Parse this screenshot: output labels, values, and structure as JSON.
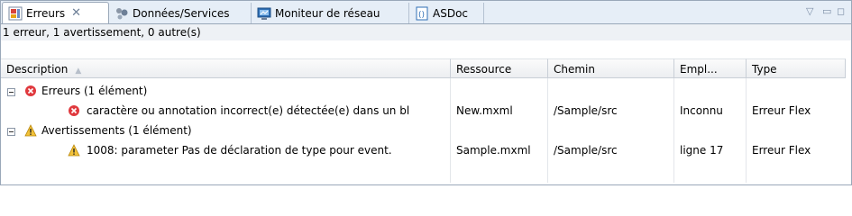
{
  "tabs": [
    {
      "label": "Erreurs",
      "icon": "problems-icon",
      "active": true,
      "closable": true
    },
    {
      "label": "Données/Services",
      "icon": "data-services-icon"
    },
    {
      "label": "Moniteur de réseau",
      "icon": "network-monitor-icon"
    },
    {
      "label": "ASDoc",
      "icon": "asdoc-icon"
    }
  ],
  "view_controls": {
    "menu": "▽",
    "minimize": "▭",
    "maximize": "◻"
  },
  "status": "1 erreur, 1 avertissement, 0 autre(s)",
  "columns": [
    "Description",
    "Ressource",
    "Chemin",
    "Empl...",
    "Type"
  ],
  "sort": {
    "column": "Description",
    "direction": "ascending"
  },
  "rows": [
    {
      "kind": "group",
      "icon": "error-icon",
      "description": "Erreurs (1 élément)"
    },
    {
      "kind": "item",
      "icon": "error-icon",
      "description": "caractère ou annotation incorrect(e) détectée(e) dans un bl",
      "resource": "New.mxml",
      "path": "/Sample/src",
      "location": "Inconnu",
      "type": "Erreur Flex"
    },
    {
      "kind": "group",
      "icon": "warning-icon",
      "description": "Avertissements (1 élément)"
    },
    {
      "kind": "item",
      "icon": "warning-icon",
      "description": "1008: parameter Pas de déclaration de type pour event.",
      "resource": "Sample.mxml",
      "path": "/Sample/src",
      "location": "ligne 17",
      "type": "Erreur Flex"
    }
  ],
  "colors": {
    "error": "#e0393e",
    "warning": "#e8a317",
    "tabbar": "#e6eef7"
  }
}
